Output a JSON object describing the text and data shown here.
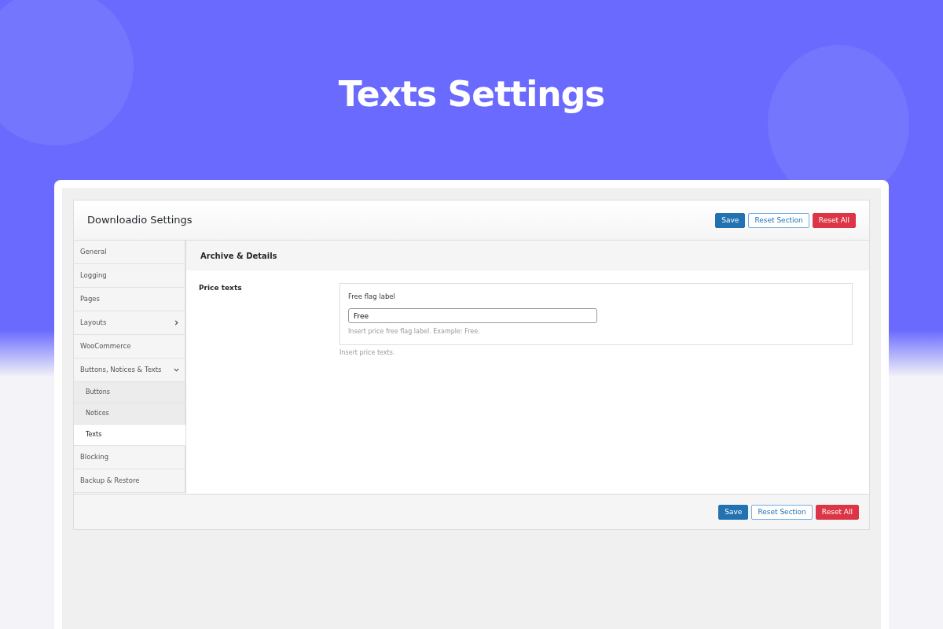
{
  "banner": {
    "title": "Texts Settings"
  },
  "settings": {
    "title": "Downloadio Settings",
    "header_buttons": [
      {
        "label": "Save",
        "kind": "primary"
      },
      {
        "label": "Reset Section",
        "kind": "outline"
      },
      {
        "label": "Reset All",
        "kind": "danger"
      }
    ],
    "sidebar": {
      "items": [
        {
          "label": "General",
          "selected": false
        },
        {
          "label": "Logging",
          "selected": false
        },
        {
          "label": "Pages",
          "selected": false
        },
        {
          "label": "Layouts",
          "selected": false,
          "expanded": false
        },
        {
          "label": "WooCommerce",
          "selected": false
        },
        {
          "label": "Buttons, Notices & Texts",
          "selected": false,
          "expanded": true,
          "children": [
            {
              "label": "Buttons",
              "selected": false
            },
            {
              "label": "Notices",
              "selected": false
            },
            {
              "label": "Texts",
              "selected": true
            }
          ]
        },
        {
          "label": "Blocking",
          "selected": false
        },
        {
          "label": "Backup & Restore",
          "selected": false
        }
      ]
    },
    "section": {
      "title": "Archive & Details",
      "fields": [
        {
          "label": "Price texts",
          "description": "Insert price texts.",
          "subfields": [
            {
              "label": "Free flag label",
              "value": "Free",
              "description": "Insert price free flag label. Example: Free."
            }
          ]
        }
      ]
    },
    "footer_buttons": [
      {
        "label": "Save",
        "kind": "primary"
      },
      {
        "label": "Reset Section",
        "kind": "outline"
      },
      {
        "label": "Reset All",
        "kind": "danger"
      }
    ]
  }
}
